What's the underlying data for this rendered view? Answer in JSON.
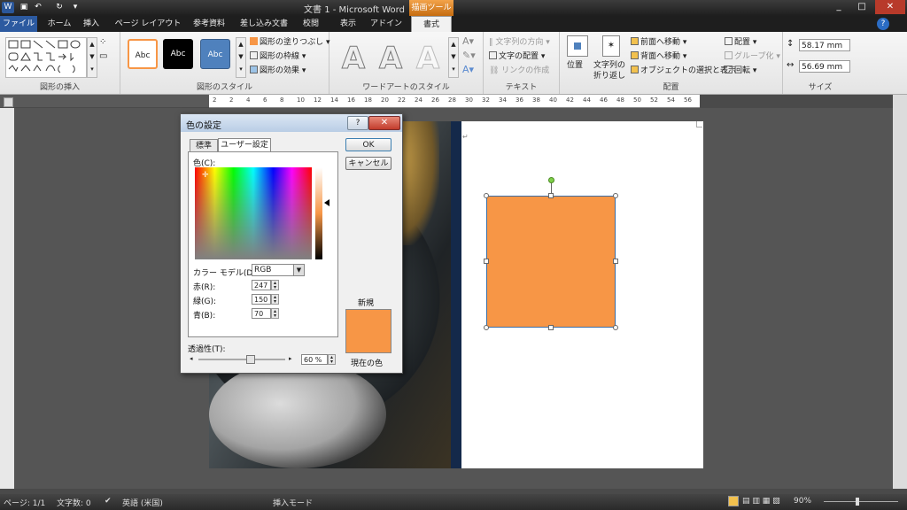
{
  "window": {
    "title": "文書 1 - Microsoft Word",
    "contextual_tab": "描画ツール",
    "controls": [
      "_",
      "□",
      "✕"
    ],
    "help": "?"
  },
  "tabs": [
    {
      "label": "ファイル"
    },
    {
      "label": "ホーム"
    },
    {
      "label": "挿入"
    },
    {
      "label": "ページ レイアウト"
    },
    {
      "label": "参考資料"
    },
    {
      "label": "差し込み文書"
    },
    {
      "label": "校閲"
    },
    {
      "label": "表示"
    },
    {
      "label": "アドイン"
    },
    {
      "label": "書式"
    }
  ],
  "ribbon": {
    "insert_shapes": {
      "label": "図形の挿入"
    },
    "shape_styles": {
      "label": "図形のスタイル",
      "styles": [
        "Abc",
        "Abc",
        "Abc"
      ],
      "fill": "図形の塗りつぶし",
      "outline": "図形の枠線",
      "effects": "図形の効果"
    },
    "wordart": {
      "label": "ワードアートのスタイル",
      "glyphs": [
        "A",
        "A",
        "A"
      ]
    },
    "text": {
      "label": "テキスト",
      "direction": "文字列の方向",
      "align": "文字の配置",
      "link": "リンクの作成"
    },
    "arrange": {
      "label": "配置",
      "position": "位置",
      "wrap_line1": "文字列の",
      "wrap_line2": "折り返し",
      "bring_forward": "前面へ移動",
      "send_backward": "背面へ移動",
      "selection_pane": "オブジェクトの選択と表示",
      "align": "配置",
      "group": "グループ化",
      "rotate": "回転"
    },
    "size": {
      "label": "サイズ",
      "height": "58.17 mm",
      "width": "56.69 mm"
    }
  },
  "ruler_ticks": [
    "2",
    "2",
    "4",
    "6",
    "8",
    "10",
    "12",
    "14",
    "16",
    "18",
    "20",
    "22",
    "24",
    "26",
    "28",
    "30",
    "32",
    "34",
    "36",
    "38",
    "40",
    "42",
    "44",
    "46",
    "48",
    "50",
    "52",
    "54",
    "56"
  ],
  "dialog": {
    "title": "色の設定",
    "tab_standard": "標準",
    "tab_custom": "ユーザー設定",
    "colors_label": "色(C):",
    "model_label": "カラー モデル(D):",
    "model_value": "RGB",
    "red_label": "赤(R):",
    "red_value": "247",
    "green_label": "緑(G):",
    "green_value": "150",
    "blue_label": "青(B):",
    "blue_value": "70",
    "transparency_label": "透過性(T):",
    "transparency_value": "60 %",
    "ok": "OK",
    "cancel": "キャンセル",
    "new_label": "新規",
    "current_label": "現在の色",
    "swatch_color": "#f79646"
  },
  "shape": {
    "fill": "#f79646"
  },
  "status": {
    "page": "ページ: 1/1",
    "words": "文字数: 0",
    "language": "英語 (米国)",
    "mode": "挿入モード",
    "zoom": "90%"
  },
  "colors": {
    "accent_orange": "#f79646",
    "file_tab": "#2c5aa0",
    "navy_bar": "#14294a"
  }
}
